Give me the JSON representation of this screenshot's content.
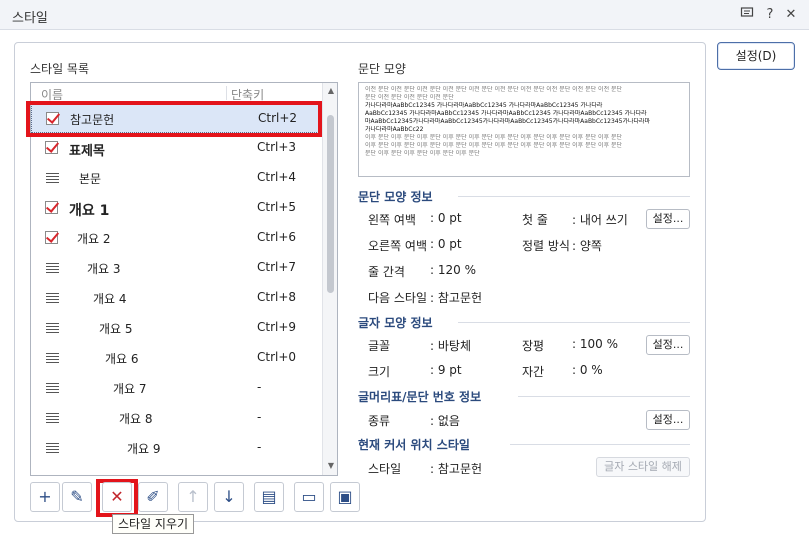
{
  "window": {
    "title": "스타일",
    "icons": [
      "message-icon",
      "help-icon",
      "close-icon"
    ],
    "help_glyph": "?",
    "close_glyph": "✕"
  },
  "set_button": {
    "label": "설정(D)"
  },
  "style_list": {
    "label": "스타일 목록",
    "header_name": "이름",
    "header_key": "단축키",
    "items": [
      {
        "name": "참고문헌",
        "key": "Ctrl+2",
        "icon": "checked-style-icon",
        "selected": true
      },
      {
        "name": "표제목",
        "key": "Ctrl+3",
        "icon": "checked-style-icon",
        "bold": true
      },
      {
        "name": "본문",
        "key": "Ctrl+4",
        "icon": "paragraph-style-icon"
      },
      {
        "name": "개요 1",
        "key": "Ctrl+5",
        "icon": "checked-style-icon",
        "bold": true
      },
      {
        "name": "개요 2",
        "key": "Ctrl+6",
        "icon": "checked-style-icon"
      },
      {
        "name": "개요 3",
        "key": "Ctrl+7",
        "icon": "paragraph-style-icon"
      },
      {
        "name": "개요 4",
        "key": "Ctrl+8",
        "icon": "paragraph-style-icon"
      },
      {
        "name": "개요 5",
        "key": "Ctrl+9",
        "icon": "paragraph-style-icon"
      },
      {
        "name": "개요 6",
        "key": "Ctrl+0",
        "icon": "paragraph-style-icon"
      },
      {
        "name": "개요 7",
        "key": "-",
        "icon": "paragraph-style-icon"
      },
      {
        "name": "개요 8",
        "key": "-",
        "icon": "paragraph-style-icon"
      },
      {
        "name": "개요 9",
        "key": "-",
        "icon": "paragraph-style-icon"
      }
    ]
  },
  "toolbar": {
    "buttons": [
      {
        "icon": "add-icon",
        "glyph": "+"
      },
      {
        "icon": "edit-pencil-icon",
        "glyph": "✎"
      },
      {
        "icon": "delete-style-icon",
        "glyph": "✕"
      },
      {
        "icon": "edit-style-icon",
        "glyph": "✐"
      },
      {
        "icon": "move-up-icon",
        "glyph": "↑",
        "disabled": true
      },
      {
        "icon": "move-down-icon",
        "glyph": "↓"
      },
      {
        "icon": "import-styles-icon",
        "glyph": "▤"
      },
      {
        "icon": "open-folder-icon",
        "glyph": "▭"
      },
      {
        "icon": "save-icon",
        "glyph": "▣"
      }
    ],
    "tooltip": "스타일 지우기"
  },
  "paragraph_preview": {
    "label": "문단 모양",
    "lines": [
      "이전 문단 이전 문단 이전 문단 이전 문단 이전 문단 이전 문단 이전 문단 이전 문단 이전 문단 이전 문단",
      "문단 이전 문단 이전 문단 이전 문단",
      "가나다라마AaBbCc12345    가나다라마AaBbCc12345    가나다라마AaBbCc12345    가나다라",
      "AaBbCc12345 가나다라마AaBbCc12345 가나다라마AaBbCc12345 가나다라마AaBbCc12345 가나다라",
      "마AaBbCc12345가나다라마AaBbCc12345가나다라마AaBbCc12345가나다라마AaBbCc12345가나다라마",
      "가나다라마AaBbCc22",
      "이후 문단 이후 문단 이후 문단 이후 문단 이후 문단 이후 문단 이후 문단 이후 문단 이후 문단 이후 문단",
      "이후 문단 이후 문단 이후 문단 이후 문단 이후 문단 이후 문단 이후 문단 이후 문단 이후 문단 이후 문단",
      "문단 이후 문단 이후 문단 이후 문단 이후 문단"
    ]
  },
  "paragraph_info": {
    "title": "문단 모양 정보",
    "left_margin_label": "왼쪽 여백",
    "left_margin_value": ": 0 pt",
    "first_line_label": "첫 줄",
    "first_line_value": ": 내어 쓰기",
    "right_margin_label": "오른쪽 여백",
    "right_margin_value": ": 0 pt",
    "align_label": "정렬 방식",
    "align_value": ": 양쪽",
    "line_spacing_label": "줄 간격",
    "line_spacing_value": ": 120 %",
    "next_style_label": "다음 스타일",
    "next_style_value": ": 참고문헌",
    "button": "설정..."
  },
  "char_info": {
    "title": "글자 모양 정보",
    "font_label": "글꼴",
    "font_value": ": 바탕체",
    "width_label": "장평",
    "width_value": ": 100 %",
    "size_label": "크기",
    "size_value": ": 9 pt",
    "spacing_label": "자간",
    "spacing_value": ": 0 %",
    "button": "설정..."
  },
  "bullet_info": {
    "title": "글머리표/문단 번호 정보",
    "type_label": "종류",
    "type_value": ": 없음",
    "button": "설정..."
  },
  "cursor_style": {
    "title": "현재 커서 위치 스타일",
    "style_label": "스타일",
    "style_value": ": 참고문헌",
    "clear_button": "글자 스타일 해제"
  },
  "highlight_color": "#e3141b"
}
